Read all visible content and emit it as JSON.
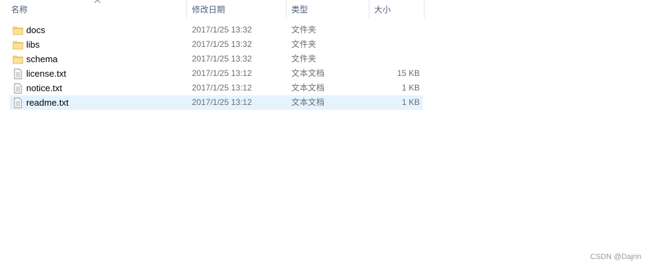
{
  "columns": {
    "name": "名称",
    "date": "修改日期",
    "type": "类型",
    "size": "大小"
  },
  "files": [
    {
      "icon": "folder-icon",
      "name": "docs",
      "date": "2017/1/25 13:32",
      "type": "文件夹",
      "size": ""
    },
    {
      "icon": "folder-icon",
      "name": "libs",
      "date": "2017/1/25 13:32",
      "type": "文件夹",
      "size": ""
    },
    {
      "icon": "folder-icon",
      "name": "schema",
      "date": "2017/1/25 13:32",
      "type": "文件夹",
      "size": ""
    },
    {
      "icon": "text-file-icon",
      "name": "license.txt",
      "date": "2017/1/25 13:12",
      "type": "文本文档",
      "size": "15 KB"
    },
    {
      "icon": "text-file-icon",
      "name": "notice.txt",
      "date": "2017/1/25 13:12",
      "type": "文本文档",
      "size": "1 KB"
    },
    {
      "icon": "text-file-icon",
      "name": "readme.txt",
      "date": "2017/1/25 13:12",
      "type": "文本文档",
      "size": "1 KB"
    }
  ],
  "selected_index": 5,
  "watermark": "CSDN @Dajrin",
  "colors": {
    "folder": "#f8d775",
    "selection": "#e5f3ff",
    "header_text": "#4c607a"
  }
}
